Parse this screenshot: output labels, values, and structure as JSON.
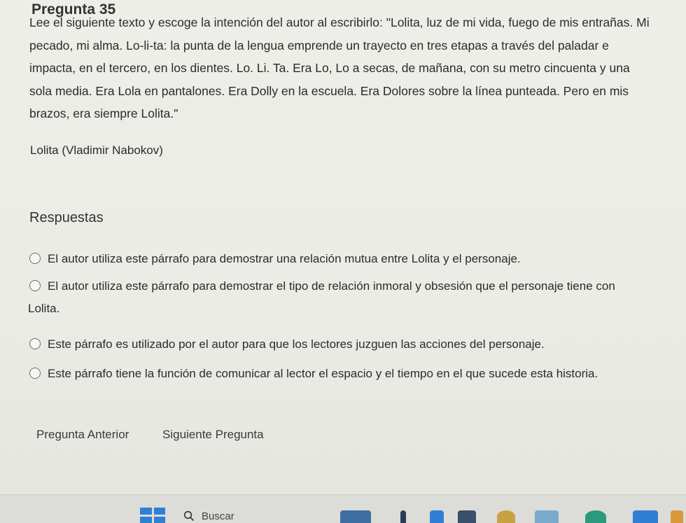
{
  "question": {
    "title": "Pregunta 35",
    "prompt": "Lee el siguiente texto y escoge la intención del autor al escribirlo: \"Lolita, luz de mi vida, fuego de mis entrañas. Mi pecado, mi alma. Lo-li-ta: la punta de la lengua emprende un trayecto en tres etapas a través del paladar e impacta, en el tercero, en los dientes. Lo. Li. Ta. Era Lo, Lo a secas, de mañana, con su metro cincuenta y una sola media. Era Lola en pantalones. Era Dolly en la escuela. Era Dolores sobre la línea punteada. Pero en mis brazos, era siempre Lolita.\"",
    "source": "Lolita (Vladimir Nabokov)"
  },
  "answers": {
    "title": "Respuestas",
    "options": [
      "El autor utiliza este párrafo para demostrar una relación mutua entre Lolita y el personaje.",
      "El autor utiliza este párrafo para demostrar el tipo de relación inmoral y obsesión que el personaje tiene con Lolita.",
      "Este párrafo es utilizado por el autor para que los lectores juzguen las acciones del personaje.",
      "Este párrafo tiene la función de comunicar al lector el espacio y el tiempo en el que sucede esta historia."
    ]
  },
  "navigation": {
    "prev_label": "Pregunta Anterior",
    "next_label": "Siguiente Pregunta"
  },
  "taskbar": {
    "search_label": "Buscar",
    "icons": [
      "windows-start-icon",
      "search-icon",
      "app-icon"
    ]
  },
  "colors": {
    "background": "#ececE6",
    "text": "#2b2b2b",
    "windows_blue": "#2f7fd4"
  }
}
